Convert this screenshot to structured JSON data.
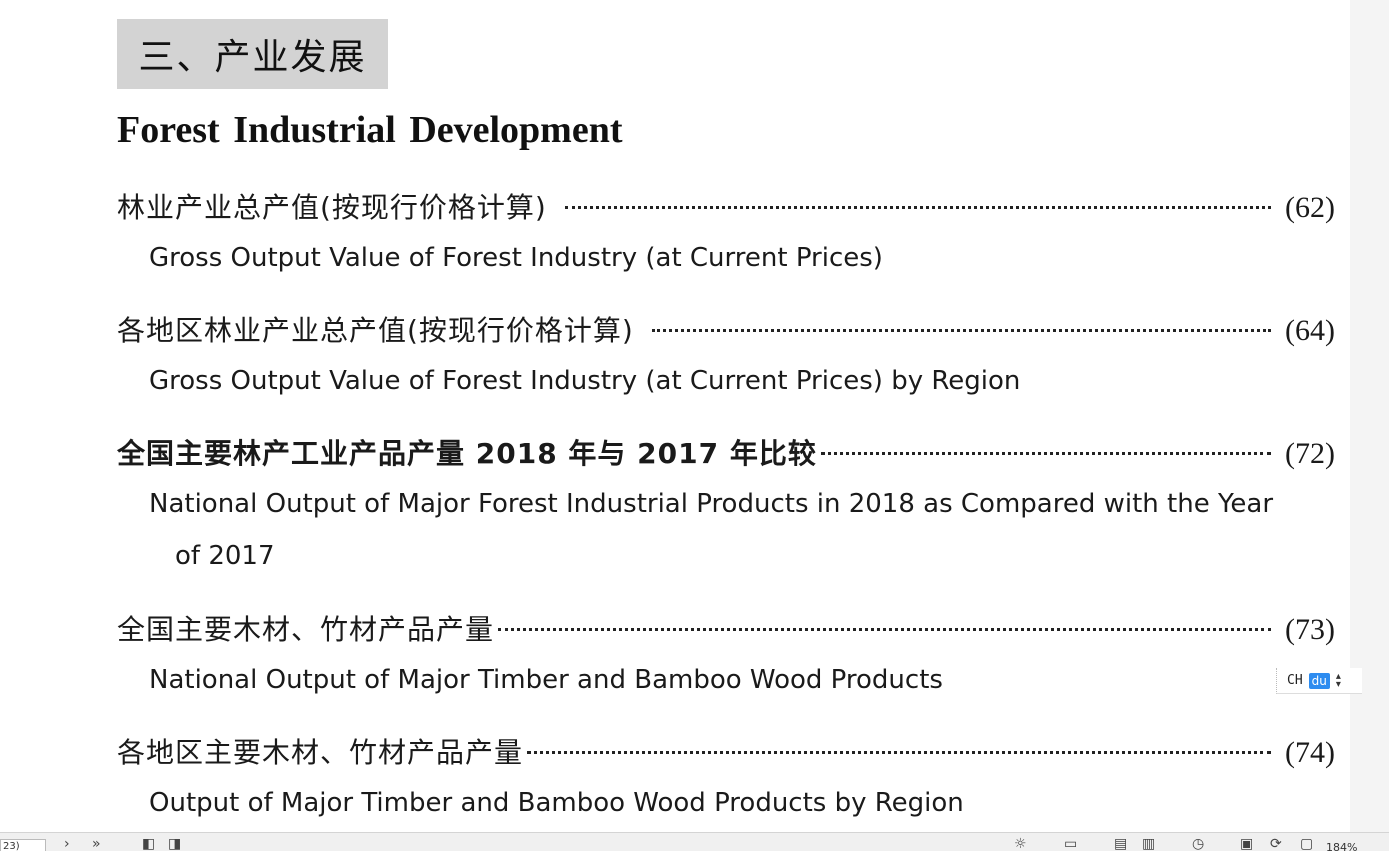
{
  "section": {
    "title_zh": "三、产业发展",
    "title_en": "Forest Industrial Development"
  },
  "entries": [
    {
      "zh": "林业产业总产值(按现行价格计算)",
      "page": "(62)",
      "en": "Gross Output Value of Forest Industry (at Current Prices)",
      "en_cont": ""
    },
    {
      "zh": "各地区林业产业总产值(按现行价格计算)",
      "page": "(64)",
      "en": "Gross Output Value of Forest Industry (at Current Prices) by Region",
      "en_cont": ""
    },
    {
      "zh": "全国主要林产工业产品产量 2018 年与 2017 年比较",
      "page": "(72)",
      "en": "National Output of Major Forest Industrial Products in 2018 as Compared with the Year",
      "en_cont": "of 2017"
    },
    {
      "zh": "全国主要木材、竹材产品产量",
      "page": "(73)",
      "en": "National Output of Major Timber and Bamboo Wood Products",
      "en_cont": ""
    },
    {
      "zh": "各地区主要木材、竹材产品产量",
      "page": "(74)",
      "en": "Output of Major Timber and Bamboo Wood Products by Region",
      "en_cont": ""
    }
  ],
  "ime": {
    "mode_label": "CH",
    "brand_label": "du"
  },
  "statusbar": {
    "page_field": "23)",
    "zoom_label": "184%"
  }
}
